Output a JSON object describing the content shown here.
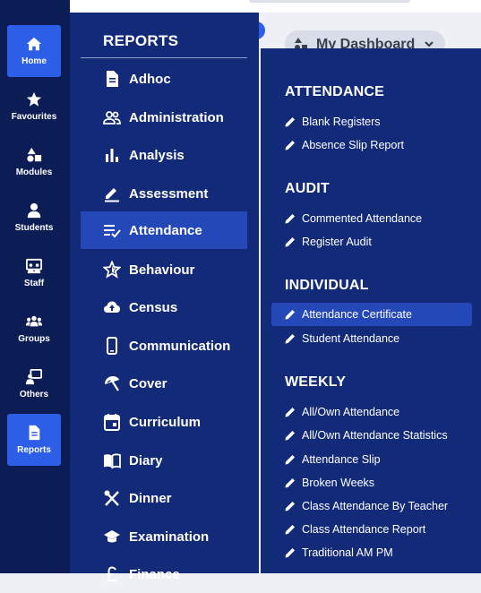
{
  "rail": {
    "items": [
      {
        "label": "Home",
        "icon": "home-icon",
        "active": true
      },
      {
        "label": "Favourites",
        "icon": "star-icon",
        "active": false
      },
      {
        "label": "Modules",
        "icon": "shapes-icon",
        "active": false
      },
      {
        "label": "Students",
        "icon": "person-icon",
        "active": false
      },
      {
        "label": "Staff",
        "icon": "presentation-icon",
        "active": false
      },
      {
        "label": "Groups",
        "icon": "people-group-icon",
        "active": false
      },
      {
        "label": "Others",
        "icon": "chalkboard-user-icon",
        "active": false
      },
      {
        "label": "Reports",
        "icon": "document-icon",
        "active": true
      }
    ]
  },
  "dashboard": {
    "label": "My Dashboard"
  },
  "reports": {
    "title": "REPORTS",
    "categories": [
      {
        "label": "Adhoc",
        "icon": "file-text-icon"
      },
      {
        "label": "Administration",
        "icon": "users-outline-icon"
      },
      {
        "label": "Analysis",
        "icon": "bar-chart-icon"
      },
      {
        "label": "Assessment",
        "icon": "edit-line-icon"
      },
      {
        "label": "Attendance",
        "icon": "list-check-icon",
        "active": true
      },
      {
        "label": "Behaviour",
        "icon": "star-outline-icon"
      },
      {
        "label": "Census",
        "icon": "cloud-upload-icon"
      },
      {
        "label": "Communication",
        "icon": "mobile-phone-icon"
      },
      {
        "label": "Cover",
        "icon": "umbrella-icon"
      },
      {
        "label": "Curriculum",
        "icon": "calendar-icon"
      },
      {
        "label": "Diary",
        "icon": "open-book-icon"
      },
      {
        "label": "Dinner",
        "icon": "utensils-icon"
      },
      {
        "label": "Examination",
        "icon": "graduation-cap-icon"
      },
      {
        "label": "Finance",
        "icon": "currency-icon"
      }
    ]
  },
  "submenu": {
    "sections": [
      {
        "heading": "ATTENDANCE",
        "items": [
          "Blank Registers",
          "Absence Slip Report"
        ]
      },
      {
        "heading": "AUDIT",
        "items": [
          "Commented Attendance",
          "Register Audit"
        ]
      },
      {
        "heading": "INDIVIDUAL",
        "items": [
          "Attendance Certificate",
          "Student Attendance"
        ],
        "active_index": 0
      },
      {
        "heading": "WEEKLY",
        "items": [
          "All/Own Attendance",
          "All/Own Attendance Statistics",
          "Attendance Slip",
          "Broken Weeks",
          "Class Attendance By Teacher",
          "Class Attendance Report",
          "Traditional AM PM"
        ]
      }
    ]
  }
}
